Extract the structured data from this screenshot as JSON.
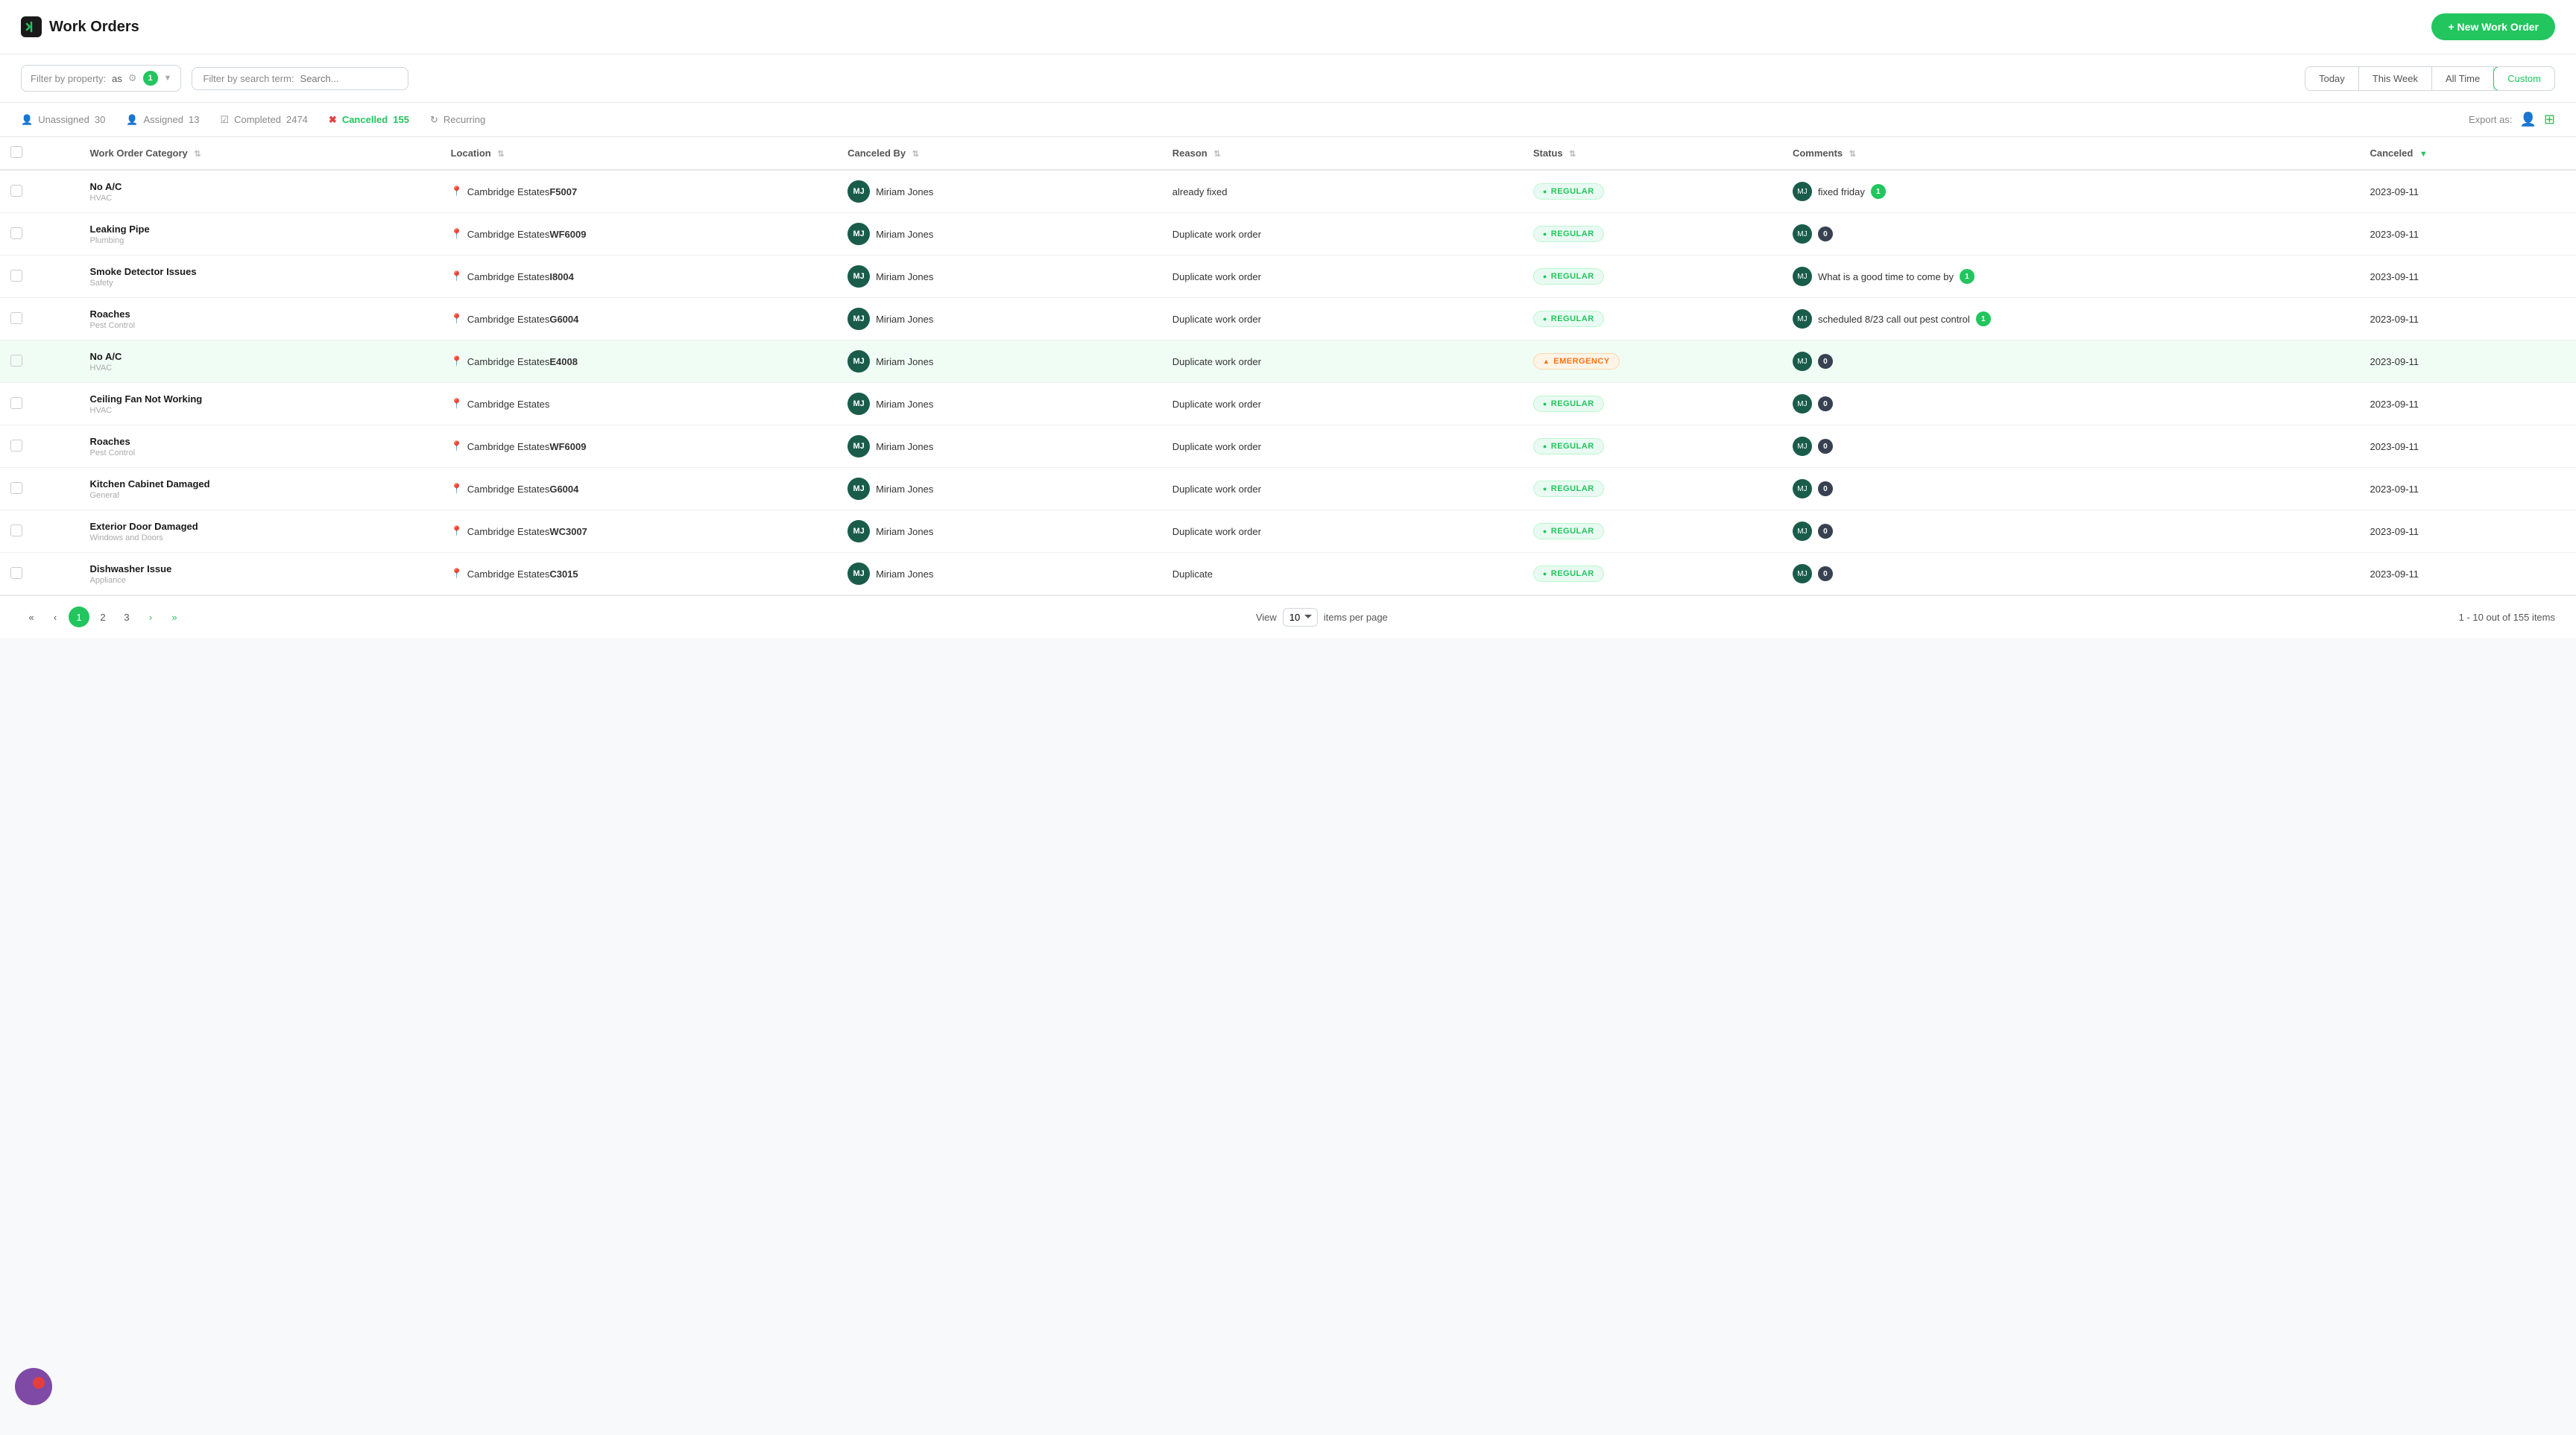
{
  "header": {
    "logo_text": "🐾",
    "title": "Work Orders",
    "new_work_order_label": "+ New Work Order"
  },
  "toolbar": {
    "filter_property_label": "Filter by property:",
    "filter_property_value": "as",
    "filter_badge_count": "1",
    "filter_search_label": "Filter by search term:",
    "filter_search_placeholder": "Search...",
    "date_buttons": [
      {
        "id": "today",
        "label": "Today",
        "active": false
      },
      {
        "id": "this-week",
        "label": "This Week",
        "active": false
      },
      {
        "id": "all-time",
        "label": "All Time",
        "active": false
      },
      {
        "id": "custom",
        "label": "Custom",
        "active": true
      }
    ]
  },
  "stats": {
    "unassigned": {
      "label": "Unassigned",
      "count": "30"
    },
    "assigned": {
      "label": "Assigned",
      "count": "13"
    },
    "completed": {
      "label": "Completed",
      "count": "2474"
    },
    "cancelled": {
      "label": "Cancelled",
      "count": "155",
      "active": true
    },
    "recurring": {
      "label": "Recurring",
      "count": ""
    }
  },
  "export": {
    "label": "Export as:"
  },
  "table": {
    "columns": [
      {
        "id": "category",
        "label": "Work Order Category",
        "sortable": true
      },
      {
        "id": "location",
        "label": "Location",
        "sortable": true
      },
      {
        "id": "cancelled_by",
        "label": "Canceled By",
        "sortable": true
      },
      {
        "id": "reason",
        "label": "Reason",
        "sortable": true
      },
      {
        "id": "status",
        "label": "Status",
        "sortable": true
      },
      {
        "id": "comments",
        "label": "Comments",
        "sortable": true
      },
      {
        "id": "cancelled",
        "label": "Canceled",
        "sortable": true,
        "sort_dir": "desc"
      }
    ],
    "rows": [
      {
        "id": 1,
        "category_name": "No A/C",
        "category_sub": "HVAC",
        "location_base": "Cambridge Estates",
        "location_unit": "F5007",
        "cancelled_by_initials": "MJ",
        "cancelled_by_name": "Miriam Jones",
        "reason": "already fixed",
        "status": "REGULAR",
        "status_type": "regular",
        "comment_text": "fixed friday",
        "comment_count": "1",
        "comment_zero": false,
        "date": "2023-09-11",
        "highlighted": false
      },
      {
        "id": 2,
        "category_name": "Leaking Pipe",
        "category_sub": "Plumbing",
        "location_base": "Cambridge Estates",
        "location_unit": "WF6009",
        "cancelled_by_initials": "MJ",
        "cancelled_by_name": "Miriam Jones",
        "reason": "Duplicate work order",
        "status": "REGULAR",
        "status_type": "regular",
        "comment_text": "",
        "comment_count": "0",
        "comment_zero": true,
        "date": "2023-09-11",
        "highlighted": false
      },
      {
        "id": 3,
        "category_name": "Smoke Detector Issues",
        "category_sub": "Safety",
        "location_base": "Cambridge Estates",
        "location_unit": "I8004",
        "cancelled_by_initials": "MJ",
        "cancelled_by_name": "Miriam Jones",
        "reason": "Duplicate work order",
        "status": "REGULAR",
        "status_type": "regular",
        "comment_text": "What is a good time to come by",
        "comment_count": "1",
        "comment_zero": false,
        "date": "2023-09-11",
        "highlighted": false
      },
      {
        "id": 4,
        "category_name": "Roaches",
        "category_sub": "Pest Control",
        "location_base": "Cambridge Estates",
        "location_unit": "G6004",
        "cancelled_by_initials": "MJ",
        "cancelled_by_name": "Miriam Jones",
        "reason": "Duplicate work order",
        "status": "REGULAR",
        "status_type": "regular",
        "comment_text": "scheduled 8/23 call out pest control",
        "comment_count": "1",
        "comment_zero": false,
        "date": "2023-09-11",
        "highlighted": false
      },
      {
        "id": 5,
        "category_name": "No A/C",
        "category_sub": "HVAC",
        "location_base": "Cambridge Estates",
        "location_unit": "E4008",
        "cancelled_by_initials": "MJ",
        "cancelled_by_name": "Miriam Jones",
        "reason": "Duplicate work order",
        "status": "EMERGENCY",
        "status_type": "emergency",
        "comment_text": "",
        "comment_count": "0",
        "comment_zero": true,
        "date": "2023-09-11",
        "highlighted": true
      },
      {
        "id": 6,
        "category_name": "Ceiling Fan Not Working",
        "category_sub": "HVAC",
        "location_base": "Cambridge Estates",
        "location_unit": "",
        "cancelled_by_initials": "MJ",
        "cancelled_by_name": "Miriam Jones",
        "reason": "Duplicate work order",
        "status": "REGULAR",
        "status_type": "regular",
        "comment_text": "",
        "comment_count": "0",
        "comment_zero": true,
        "date": "2023-09-11",
        "highlighted": false
      },
      {
        "id": 7,
        "category_name": "Roaches",
        "category_sub": "Pest Control",
        "location_base": "Cambridge Estates",
        "location_unit": "WF6009",
        "cancelled_by_initials": "MJ",
        "cancelled_by_name": "Miriam Jones",
        "reason": "Duplicate work order",
        "status": "REGULAR",
        "status_type": "regular",
        "comment_text": "",
        "comment_count": "0",
        "comment_zero": true,
        "date": "2023-09-11",
        "highlighted": false
      },
      {
        "id": 8,
        "category_name": "Kitchen Cabinet Damaged",
        "category_sub": "General",
        "location_base": "Cambridge Estates",
        "location_unit": "G6004",
        "cancelled_by_initials": "MJ",
        "cancelled_by_name": "Miriam Jones",
        "reason": "Duplicate work order",
        "status": "REGULAR",
        "status_type": "regular",
        "comment_text": "",
        "comment_count": "0",
        "comment_zero": true,
        "date": "2023-09-11",
        "highlighted": false
      },
      {
        "id": 9,
        "category_name": "Exterior Door Damaged",
        "category_sub": "Windows and Doors",
        "location_base": "Cambridge Estates",
        "location_unit": "WC3007",
        "cancelled_by_initials": "MJ",
        "cancelled_by_name": "Miriam Jones",
        "reason": "Duplicate work order",
        "status": "REGULAR",
        "status_type": "regular",
        "comment_text": "",
        "comment_count": "0",
        "comment_zero": true,
        "date": "2023-09-11",
        "highlighted": false
      },
      {
        "id": 10,
        "category_name": "Dishwasher Issue",
        "category_sub": "Appliance",
        "location_base": "Cambridge Estates",
        "location_unit": "C3015",
        "cancelled_by_initials": "MJ",
        "cancelled_by_name": "Miriam Jones",
        "reason": "Duplicate",
        "status": "REGULAR",
        "status_type": "regular",
        "comment_text": "",
        "comment_count": "0",
        "comment_zero": true,
        "date": "2023-09-11",
        "highlighted": false
      }
    ]
  },
  "pagination": {
    "pages": [
      "1",
      "2",
      "3"
    ],
    "active_page": "1",
    "view_label": "View",
    "items_per_page": "10",
    "items_label": "items per page",
    "range_label": "1 - 10 out of 155 items"
  }
}
